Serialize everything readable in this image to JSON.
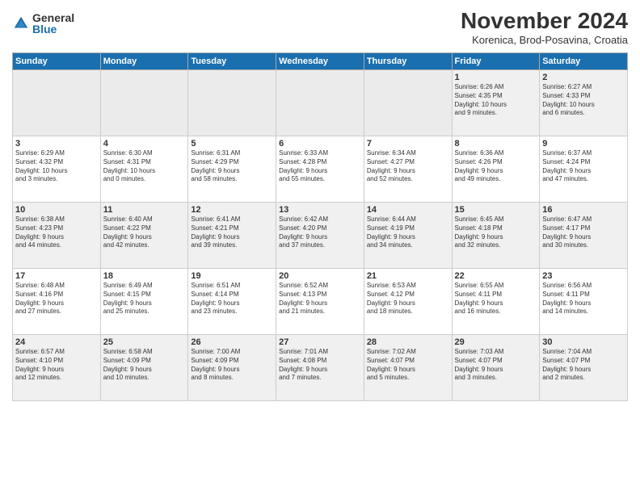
{
  "logo": {
    "general": "General",
    "blue": "Blue"
  },
  "title": "November 2024",
  "location": "Korenica, Brod-Posavina, Croatia",
  "weekdays": [
    "Sunday",
    "Monday",
    "Tuesday",
    "Wednesday",
    "Thursday",
    "Friday",
    "Saturday"
  ],
  "weeks": [
    [
      {
        "day": "",
        "info": ""
      },
      {
        "day": "",
        "info": ""
      },
      {
        "day": "",
        "info": ""
      },
      {
        "day": "",
        "info": ""
      },
      {
        "day": "",
        "info": ""
      },
      {
        "day": "1",
        "info": "Sunrise: 6:26 AM\nSunset: 4:35 PM\nDaylight: 10 hours\nand 9 minutes."
      },
      {
        "day": "2",
        "info": "Sunrise: 6:27 AM\nSunset: 4:33 PM\nDaylight: 10 hours\nand 6 minutes."
      }
    ],
    [
      {
        "day": "3",
        "info": "Sunrise: 6:29 AM\nSunset: 4:32 PM\nDaylight: 10 hours\nand 3 minutes."
      },
      {
        "day": "4",
        "info": "Sunrise: 6:30 AM\nSunset: 4:31 PM\nDaylight: 10 hours\nand 0 minutes."
      },
      {
        "day": "5",
        "info": "Sunrise: 6:31 AM\nSunset: 4:29 PM\nDaylight: 9 hours\nand 58 minutes."
      },
      {
        "day": "6",
        "info": "Sunrise: 6:33 AM\nSunset: 4:28 PM\nDaylight: 9 hours\nand 55 minutes."
      },
      {
        "day": "7",
        "info": "Sunrise: 6:34 AM\nSunset: 4:27 PM\nDaylight: 9 hours\nand 52 minutes."
      },
      {
        "day": "8",
        "info": "Sunrise: 6:36 AM\nSunset: 4:26 PM\nDaylight: 9 hours\nand 49 minutes."
      },
      {
        "day": "9",
        "info": "Sunrise: 6:37 AM\nSunset: 4:24 PM\nDaylight: 9 hours\nand 47 minutes."
      }
    ],
    [
      {
        "day": "10",
        "info": "Sunrise: 6:38 AM\nSunset: 4:23 PM\nDaylight: 9 hours\nand 44 minutes."
      },
      {
        "day": "11",
        "info": "Sunrise: 6:40 AM\nSunset: 4:22 PM\nDaylight: 9 hours\nand 42 minutes."
      },
      {
        "day": "12",
        "info": "Sunrise: 6:41 AM\nSunset: 4:21 PM\nDaylight: 9 hours\nand 39 minutes."
      },
      {
        "day": "13",
        "info": "Sunrise: 6:42 AM\nSunset: 4:20 PM\nDaylight: 9 hours\nand 37 minutes."
      },
      {
        "day": "14",
        "info": "Sunrise: 6:44 AM\nSunset: 4:19 PM\nDaylight: 9 hours\nand 34 minutes."
      },
      {
        "day": "15",
        "info": "Sunrise: 6:45 AM\nSunset: 4:18 PM\nDaylight: 9 hours\nand 32 minutes."
      },
      {
        "day": "16",
        "info": "Sunrise: 6:47 AM\nSunset: 4:17 PM\nDaylight: 9 hours\nand 30 minutes."
      }
    ],
    [
      {
        "day": "17",
        "info": "Sunrise: 6:48 AM\nSunset: 4:16 PM\nDaylight: 9 hours\nand 27 minutes."
      },
      {
        "day": "18",
        "info": "Sunrise: 6:49 AM\nSunset: 4:15 PM\nDaylight: 9 hours\nand 25 minutes."
      },
      {
        "day": "19",
        "info": "Sunrise: 6:51 AM\nSunset: 4:14 PM\nDaylight: 9 hours\nand 23 minutes."
      },
      {
        "day": "20",
        "info": "Sunrise: 6:52 AM\nSunset: 4:13 PM\nDaylight: 9 hours\nand 21 minutes."
      },
      {
        "day": "21",
        "info": "Sunrise: 6:53 AM\nSunset: 4:12 PM\nDaylight: 9 hours\nand 18 minutes."
      },
      {
        "day": "22",
        "info": "Sunrise: 6:55 AM\nSunset: 4:11 PM\nDaylight: 9 hours\nand 16 minutes."
      },
      {
        "day": "23",
        "info": "Sunrise: 6:56 AM\nSunset: 4:11 PM\nDaylight: 9 hours\nand 14 minutes."
      }
    ],
    [
      {
        "day": "24",
        "info": "Sunrise: 6:57 AM\nSunset: 4:10 PM\nDaylight: 9 hours\nand 12 minutes."
      },
      {
        "day": "25",
        "info": "Sunrise: 6:58 AM\nSunset: 4:09 PM\nDaylight: 9 hours\nand 10 minutes."
      },
      {
        "day": "26",
        "info": "Sunrise: 7:00 AM\nSunset: 4:09 PM\nDaylight: 9 hours\nand 8 minutes."
      },
      {
        "day": "27",
        "info": "Sunrise: 7:01 AM\nSunset: 4:08 PM\nDaylight: 9 hours\nand 7 minutes."
      },
      {
        "day": "28",
        "info": "Sunrise: 7:02 AM\nSunset: 4:07 PM\nDaylight: 9 hours\nand 5 minutes."
      },
      {
        "day": "29",
        "info": "Sunrise: 7:03 AM\nSunset: 4:07 PM\nDaylight: 9 hours\nand 3 minutes."
      },
      {
        "day": "30",
        "info": "Sunrise: 7:04 AM\nSunset: 4:07 PM\nDaylight: 9 hours\nand 2 minutes."
      }
    ]
  ]
}
